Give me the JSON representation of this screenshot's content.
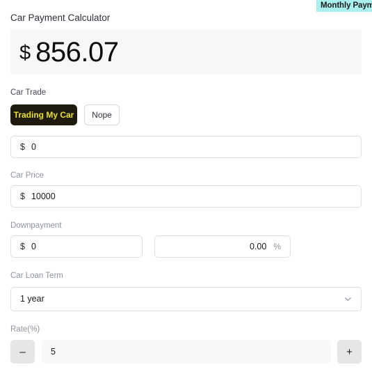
{
  "badge": {
    "label": "Monthly Payment",
    "background_color": "#aaf0ee"
  },
  "header": {
    "title": "Car Payment Calculator"
  },
  "payment_display": {
    "currency_symbol": "$",
    "amount": "856.07",
    "background_color": "#f7f7f7"
  },
  "car_trade": {
    "label": "Car Trade",
    "options": [
      {
        "label": "Trading My Car",
        "selected": true
      },
      {
        "label": "Nope",
        "selected": false
      }
    ],
    "active_background": "#1e1a0e",
    "active_text_color": "#e9e22e",
    "value_field": {
      "prefix": "$",
      "value": "0"
    }
  },
  "car_price": {
    "label": "Car Price",
    "prefix": "$",
    "value": "10000"
  },
  "downpayment": {
    "label": "Downpayment",
    "amount_field": {
      "prefix": "$",
      "value": "0"
    },
    "percent_field": {
      "value": "0.00",
      "suffix": "%"
    }
  },
  "car_loan_term": {
    "label": "Car Loan Term",
    "selected": "1 year",
    "chevron_icon": "chevron-down-icon"
  },
  "rate": {
    "label": "Rate(%)",
    "decrement_label": "–",
    "increment_label": "+",
    "value": "5"
  }
}
